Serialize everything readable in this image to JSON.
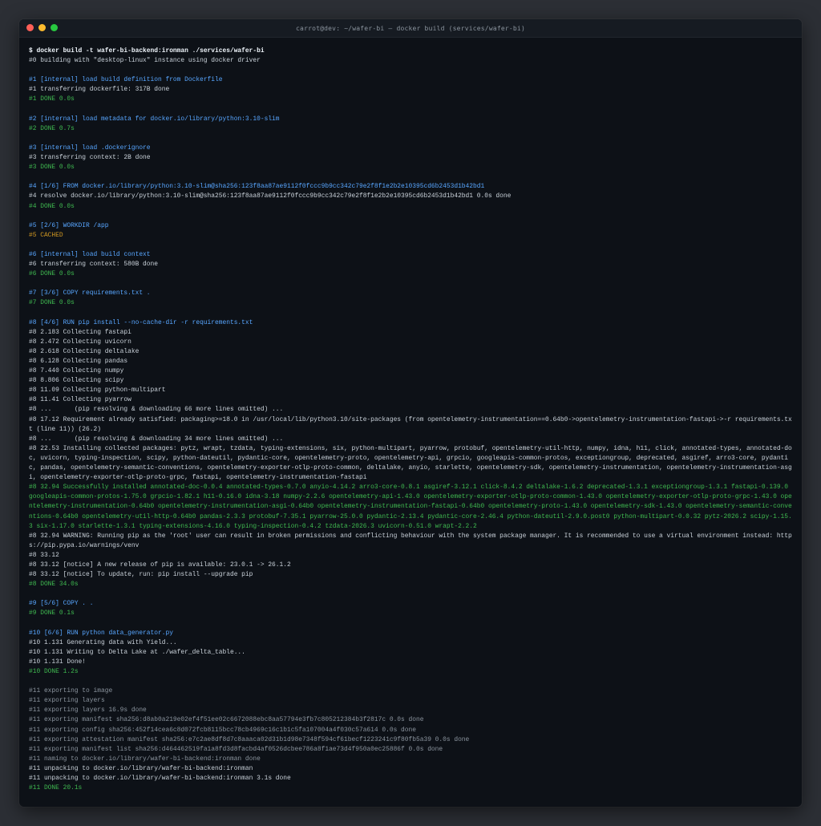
{
  "window": {
    "title": "carrot@dev: ~/wafer-bi — docker build (services/wafer-bi)"
  },
  "colors": {
    "cmd": "#f0f6fc",
    "normal": "#c9d1d9",
    "header": "#58a6ff",
    "done": "#3fb950",
    "cached": "#d29922",
    "dim": "#8b949e"
  },
  "terminal": {
    "lines": [
      {
        "t": "cmd",
        "text": "$ docker build -t wafer-bi-backend:ironman ./services/wafer-bi"
      },
      {
        "t": "normal",
        "text": "#0 building with \"desktop-linux\" instance using docker driver"
      },
      {
        "t": "blank",
        "text": ""
      },
      {
        "t": "header",
        "text": "#1 [internal] load build definition from Dockerfile"
      },
      {
        "t": "normal",
        "text": "#1 transferring dockerfile: 317B done"
      },
      {
        "t": "done",
        "text": "#1 DONE 0.0s"
      },
      {
        "t": "blank",
        "text": ""
      },
      {
        "t": "header",
        "text": "#2 [internal] load metadata for docker.io/library/python:3.10-slim"
      },
      {
        "t": "done",
        "text": "#2 DONE 0.7s"
      },
      {
        "t": "blank",
        "text": ""
      },
      {
        "t": "header",
        "text": "#3 [internal] load .dockerignore"
      },
      {
        "t": "normal",
        "text": "#3 transferring context: 2B done"
      },
      {
        "t": "done",
        "text": "#3 DONE 0.0s"
      },
      {
        "t": "blank",
        "text": ""
      },
      {
        "t": "header",
        "text": "#4 [1/6] FROM docker.io/library/python:3.10-slim@sha256:123f8aa87ae9112f0fccc9b9cc342c79e2f8f1e2b2e10395cd6b2453d1b42bd1"
      },
      {
        "t": "normal",
        "text": "#4 resolve docker.io/library/python:3.10-slim@sha256:123f8aa87ae9112f0fccc9b9cc342c79e2f8f1e2b2e10395cd6b2453d1b42bd1 0.0s done"
      },
      {
        "t": "done",
        "text": "#4 DONE 0.0s"
      },
      {
        "t": "blank",
        "text": ""
      },
      {
        "t": "header",
        "text": "#5 [2/6] WORKDIR /app"
      },
      {
        "t": "cached",
        "text": "#5 CACHED"
      },
      {
        "t": "blank",
        "text": ""
      },
      {
        "t": "header",
        "text": "#6 [internal] load build context"
      },
      {
        "t": "normal",
        "text": "#6 transferring context: 580B done"
      },
      {
        "t": "done",
        "text": "#6 DONE 0.0s"
      },
      {
        "t": "blank",
        "text": ""
      },
      {
        "t": "header",
        "text": "#7 [3/6] COPY requirements.txt ."
      },
      {
        "t": "done",
        "text": "#7 DONE 0.0s"
      },
      {
        "t": "blank",
        "text": ""
      },
      {
        "t": "header",
        "text": "#8 [4/6] RUN pip install --no-cache-dir -r requirements.txt"
      },
      {
        "t": "normal",
        "text": "#8 2.183 Collecting fastapi"
      },
      {
        "t": "normal",
        "text": "#8 2.472 Collecting uvicorn"
      },
      {
        "t": "normal",
        "text": "#8 2.618 Collecting deltalake"
      },
      {
        "t": "normal",
        "text": "#8 6.128 Collecting pandas"
      },
      {
        "t": "normal",
        "text": "#8 7.440 Collecting numpy"
      },
      {
        "t": "normal",
        "text": "#8 8.806 Collecting scipy"
      },
      {
        "t": "normal",
        "text": "#8 11.09 Collecting python-multipart"
      },
      {
        "t": "normal",
        "text": "#8 11.41 Collecting pyarrow"
      },
      {
        "t": "normal",
        "text": "#8 ...      (pip resolving & downloading 66 more lines omitted) ..."
      },
      {
        "t": "normal",
        "text": "#8 17.12 Requirement already satisfied: packaging>=18.0 in /usr/local/lib/python3.10/site-packages (from opentelemetry-instrumentation==0.64b0->opentelemetry-instrumentation-fastapi->-r requirements.txt (line 11)) (26.2)"
      },
      {
        "t": "normal",
        "text": "#8 ...      (pip resolving & downloading 34 more lines omitted) ..."
      },
      {
        "t": "normal",
        "text": "#8 22.53 Installing collected packages: pytz, wrapt, tzdata, typing-extensions, six, python-multipart, pyarrow, protobuf, opentelemetry-util-http, numpy, idna, h11, click, annotated-types, annotated-doc, uvicorn, typing-inspection, scipy, python-dateutil, pydantic-core, opentelemetry-proto, opentelemetry-api, grpcio, googleapis-common-protos, exceptiongroup, deprecated, asgiref, arro3-core, pydantic, pandas, opentelemetry-semantic-conventions, opentelemetry-exporter-otlp-proto-common, deltalake, anyio, starlette, opentelemetry-sdk, opentelemetry-instrumentation, opentelemetry-instrumentation-asgi, opentelemetry-exporter-otlp-proto-grpc, fastapi, opentelemetry-instrumentation-fastapi"
      },
      {
        "t": "done",
        "text": "#8 32.94 Successfully installed annotated-doc-0.0.4 annotated-types-0.7.0 anyio-4.14.2 arro3-core-0.8.1 asgiref-3.12.1 click-8.4.2 deltalake-1.6.2 deprecated-1.3.1 exceptiongroup-1.3.1 fastapi-0.139.0 googleapis-common-protos-1.75.0 grpcio-1.82.1 h11-0.16.0 idna-3.18 numpy-2.2.6 opentelemetry-api-1.43.0 opentelemetry-exporter-otlp-proto-common-1.43.0 opentelemetry-exporter-otlp-proto-grpc-1.43.0 opentelemetry-instrumentation-0.64b0 opentelemetry-instrumentation-asgi-0.64b0 opentelemetry-instrumentation-fastapi-0.64b0 opentelemetry-proto-1.43.0 opentelemetry-sdk-1.43.0 opentelemetry-semantic-conventions-0.64b0 opentelemetry-util-http-0.64b0 pandas-2.3.3 protobuf-7.35.1 pyarrow-25.0.0 pydantic-2.13.4 pydantic-core-2.46.4 python-dateutil-2.9.0.post0 python-multipart-0.0.32 pytz-2026.2 scipy-1.15.3 six-1.17.0 starlette-1.3.1 typing-extensions-4.16.0 typing-inspection-0.4.2 tzdata-2026.3 uvicorn-0.51.0 wrapt-2.2.2"
      },
      {
        "t": "normal",
        "text": "#8 32.94 WARNING: Running pip as the 'root' user can result in broken permissions and conflicting behaviour with the system package manager. It is recommended to use a virtual environment instead: https://pip.pypa.io/warnings/venv"
      },
      {
        "t": "normal",
        "text": "#8 33.12"
      },
      {
        "t": "normal",
        "text": "#8 33.12 [notice] A new release of pip is available: 23.0.1 -> 26.1.2"
      },
      {
        "t": "normal",
        "text": "#8 33.12 [notice] To update, run: pip install --upgrade pip"
      },
      {
        "t": "done",
        "text": "#8 DONE 34.0s"
      },
      {
        "t": "blank",
        "text": ""
      },
      {
        "t": "header",
        "text": "#9 [5/6] COPY . ."
      },
      {
        "t": "done",
        "text": "#9 DONE 0.1s"
      },
      {
        "t": "blank",
        "text": ""
      },
      {
        "t": "header",
        "text": "#10 [6/6] RUN python data_generator.py"
      },
      {
        "t": "normal",
        "text": "#10 1.131 Generating data with Yield..."
      },
      {
        "t": "normal",
        "text": "#10 1.131 Writing to Delta Lake at ./wafer_delta_table..."
      },
      {
        "t": "normal",
        "text": "#10 1.131 Done!"
      },
      {
        "t": "done",
        "text": "#10 DONE 1.2s"
      },
      {
        "t": "blank",
        "text": ""
      },
      {
        "t": "dim",
        "text": "#11 exporting to image"
      },
      {
        "t": "dim",
        "text": "#11 exporting layers"
      },
      {
        "t": "dim",
        "text": "#11 exporting layers 16.9s done"
      },
      {
        "t": "dim",
        "text": "#11 exporting manifest sha256:d8ab0a219e02ef4f51ee02c6672088ebc8aa57794e3fb7c805212384b3f2817c 0.0s done"
      },
      {
        "t": "dim",
        "text": "#11 exporting config sha256:452f14cea6c8d072fcb8115bcc78cb4969c16c1b1c5fa107004a4f030c57a614 0.0s done"
      },
      {
        "t": "dim",
        "text": "#11 exporting attestation manifest sha256:e7c2ae8df8d7c8aaaca02d31b1d98e7348f594cf61becf1223241c9f80fb5a39 0.0s done"
      },
      {
        "t": "dim",
        "text": "#11 exporting manifest list sha256:d464462519fa1a8fd3d8facbd4af0526dcbee786a8f1ae73d4f950a0ec25886f 0.0s done"
      },
      {
        "t": "dim",
        "text": "#11 naming to docker.io/library/wafer-bi-backend:ironman done"
      },
      {
        "t": "normal",
        "text": "#11 unpacking to docker.io/library/wafer-bi-backend:ironman"
      },
      {
        "t": "normal",
        "text": "#11 unpacking to docker.io/library/wafer-bi-backend:ironman 3.1s done"
      },
      {
        "t": "done",
        "text": "#11 DONE 20.1s"
      }
    ]
  }
}
